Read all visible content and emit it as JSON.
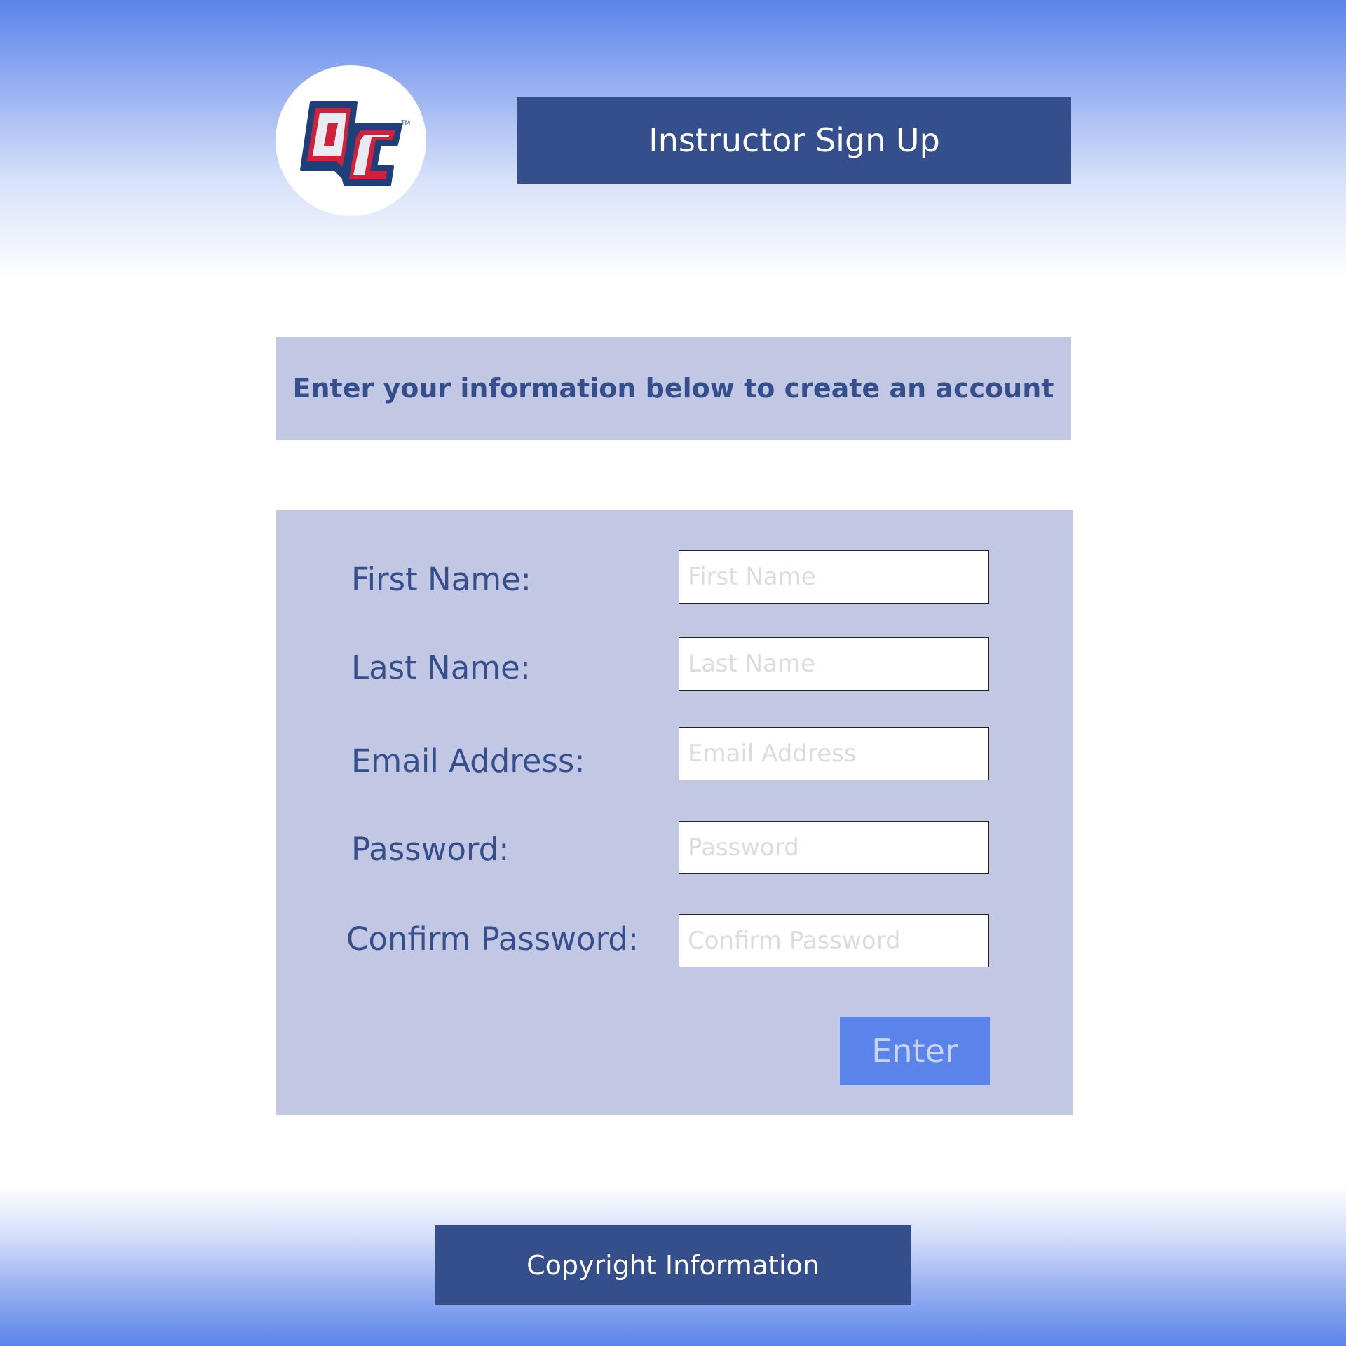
{
  "header": {
    "logo_text": "QC",
    "title": "Instructor Sign Up"
  },
  "instructions": "Enter your information below to create an account",
  "form": {
    "fields": [
      {
        "label": "First Name:",
        "placeholder": "First Name",
        "value": ""
      },
      {
        "label": "Last Name:",
        "placeholder": "Last Name",
        "value": ""
      },
      {
        "label": "Email Address:",
        "placeholder": "Email Address",
        "value": ""
      },
      {
        "label": "Password:",
        "placeholder": "Password",
        "value": ""
      },
      {
        "label": "Confirm Password:",
        "placeholder": "Confirm Password",
        "value": ""
      }
    ],
    "submit_label": "Enter"
  },
  "footer": {
    "label": "Copyright Information"
  },
  "colors": {
    "primary": "#344f8c",
    "accent": "#5a84ea",
    "panel": "#c2c8e4",
    "logo_red": "#d2203b"
  }
}
